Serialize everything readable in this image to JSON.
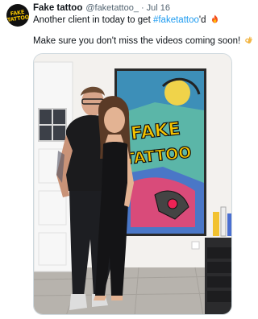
{
  "tweet": {
    "author": {
      "display_name": "Fake tattoo",
      "handle": "@faketattoo_",
      "avatar_text": "FAKE TATTOO"
    },
    "separator": "·",
    "date": "Jul 16",
    "text_line1_prefix": "Another client in today to get ",
    "hashtag": "#faketattoo",
    "text_line1_suffix": "'d",
    "text_line2": "Make sure you don't miss the videos coming soon!",
    "emoji_1": "fire-emoji",
    "emoji_2": "ok-hand-emoji",
    "media": {
      "alt": "Photo of two people posing in front of a graffiti-style FAKE TATTOO painting",
      "painting_text_top": "FAKE",
      "painting_text_bottom": "TATTOO"
    }
  },
  "colors": {
    "link": "#1d9bf0",
    "secondary_text": "#536471",
    "primary_text": "#0f1419",
    "border": "#cfd9de",
    "logo_yellow": "#f5c400"
  }
}
